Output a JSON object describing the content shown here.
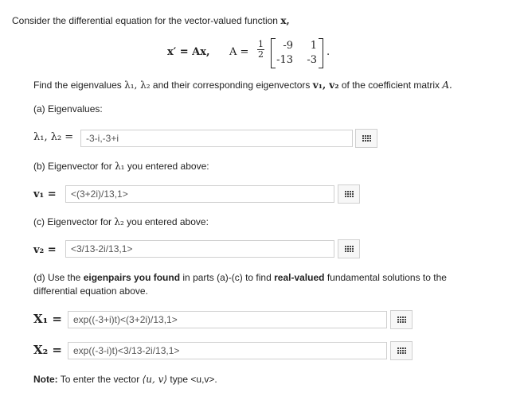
{
  "intro": "Consider the differential equation for the vector-valued function",
  "intro_var": "x,",
  "equation": {
    "lhs": "x′ = Ax,",
    "a_label": "A =",
    "frac_num": "1",
    "frac_den": "2",
    "matrix": [
      [
        "-9",
        "1"
      ],
      [
        "-13",
        "-3"
      ]
    ],
    "end": "."
  },
  "find_text_1": "Find the eigenvalues",
  "find_lambdas": "λ₁, λ₂",
  "find_text_2": "and their corresponding eigenvectors",
  "find_vs": "v₁, v₂",
  "find_text_3": "of the coefficient matrix",
  "find_A": "A.",
  "part_a": {
    "label": "(a) Eigenvalues:",
    "var": "λ₁, λ₂ =",
    "value": "-3-i,-3+i"
  },
  "part_b": {
    "label_pre": "(b) Eigenvector for",
    "label_var": "λ₁",
    "label_post": "you entered above:",
    "var": "v₁ =",
    "value": "<(3+2i)/13,1>"
  },
  "part_c": {
    "label_pre": "(c) Eigenvector for",
    "label_var": "λ₂",
    "label_post": "you entered above:",
    "var": "v₂ =",
    "value": "<3/13-2i/13,1>"
  },
  "part_d": {
    "line1_pre": "(d) Use the",
    "line1_bold1": "eigenpairs you found",
    "line1_mid": "in parts (a)-(c) to find",
    "line1_bold2": "real-valued",
    "line1_post": "fundamental solutions to the",
    "line2": "differential equation above.",
    "x1_var": "X₁ =",
    "x1_value": "exp((-3+i)t)<(3+2i)/13,1>",
    "x2_var": "X₂ =",
    "x2_value": "exp((-3-i)t)<3/13-2i/13,1>"
  },
  "note": {
    "bold": "Note:",
    "text_pre": "To enter the vector",
    "vector": "⟨u, v⟩",
    "text_post": "type <u,v>."
  }
}
